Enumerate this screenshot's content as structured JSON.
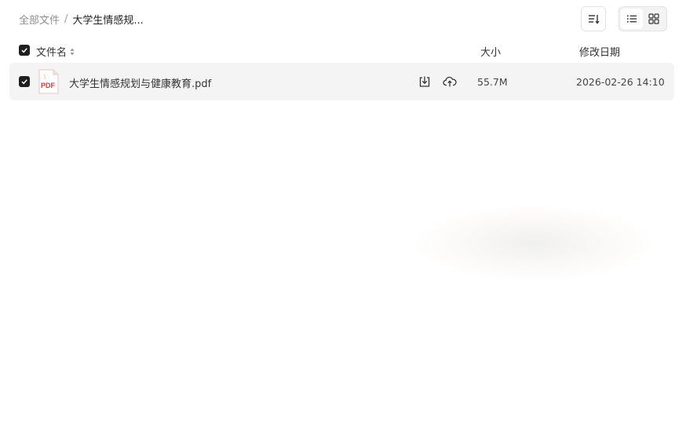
{
  "breadcrumb": {
    "root": "全部文件",
    "separator": "/",
    "current": "大学生情感规..."
  },
  "toolbar": {
    "sort_icon": "sort-list-icon",
    "view_list_icon": "list-view-icon",
    "view_grid_icon": "grid-view-icon",
    "active_view": "list"
  },
  "table": {
    "columns": {
      "name": "文件名",
      "size": "大小",
      "modified": "修改日期"
    },
    "all_selected": true,
    "rows": [
      {
        "selected": true,
        "icon": "pdf-file-icon",
        "icon_label": "PDF",
        "name": "大学生情感规划与健康教育.pdf",
        "size": "55.7M",
        "modified": "2026-02-26 14:10"
      }
    ]
  },
  "colors": {
    "row_bg": "#f4f4f4",
    "pdf_red": "#e3342f",
    "checkbox": "#1f1f1f"
  }
}
